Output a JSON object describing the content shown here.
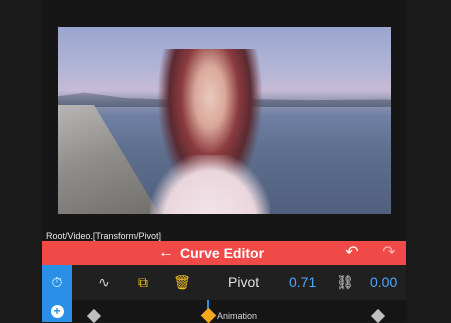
{
  "path": "Root/Video.[Transform/Pivot]",
  "header": {
    "back_icon": "←",
    "title": "Curve Editor",
    "undo_icon": "↶",
    "redo_icon": "↷",
    "accent": "#f04a48"
  },
  "toolbar": {
    "clock_icon": "⏱",
    "graph_icon": "∿",
    "copy_icon": "⧉",
    "trash_icon": "🗑",
    "pivot_label": "Pivot",
    "value1": "0.71",
    "link_icon": "⛓",
    "value2": "0.00"
  },
  "timeline": {
    "add_icon": "+",
    "label": "Animation"
  }
}
